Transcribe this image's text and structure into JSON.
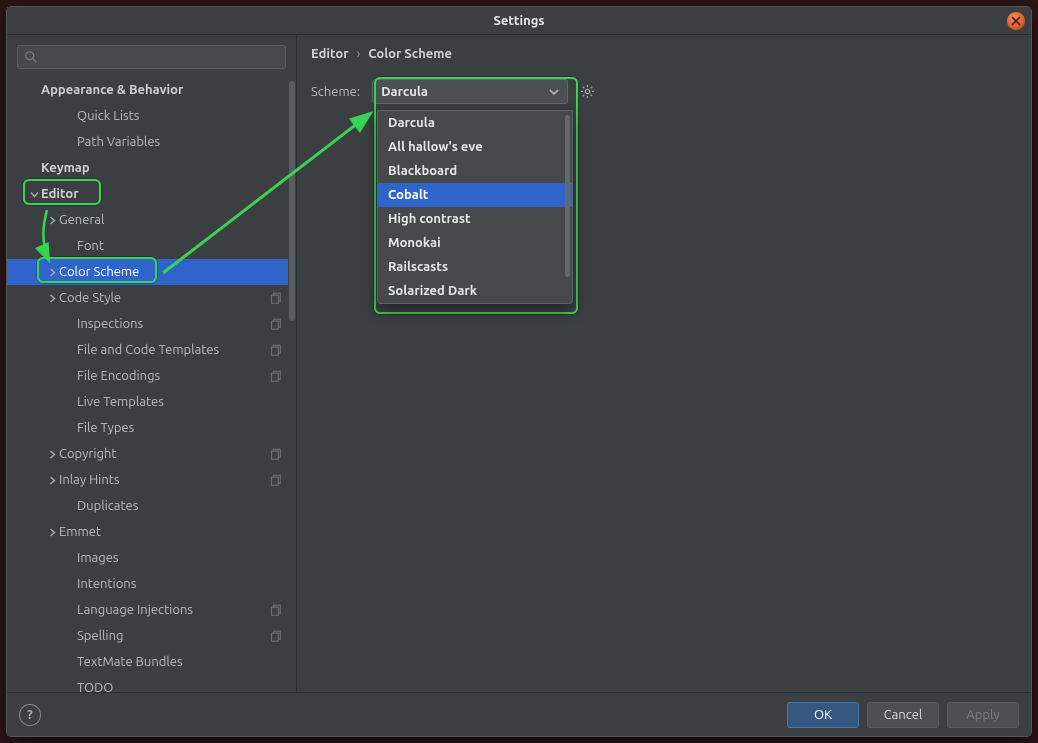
{
  "window": {
    "title": "Settings"
  },
  "breadcrumb": {
    "parent": "Editor",
    "current": "Color Scheme"
  },
  "scheme": {
    "label": "Scheme:",
    "selected": "Darcula",
    "options": [
      "Darcula",
      "All hallow's eve",
      "Blackboard",
      "Cobalt",
      "High contrast",
      "Monokai",
      "Railscasts",
      "Solarized Dark"
    ],
    "highlighted": "Cobalt"
  },
  "sidebar": {
    "search_placeholder": "",
    "items": [
      {
        "label": "Appearance & Behavior",
        "bold": true,
        "indent": 0
      },
      {
        "label": "Quick Lists",
        "indent": 2
      },
      {
        "label": "Path Variables",
        "indent": 2
      },
      {
        "label": "Keymap",
        "bold": true,
        "indent": 0
      },
      {
        "label": "Editor",
        "bold": true,
        "indent": 0,
        "arrow": "down",
        "hl": true
      },
      {
        "label": "General",
        "indent": 1,
        "arrow": "right"
      },
      {
        "label": "Font",
        "indent": 2
      },
      {
        "label": "Color Scheme",
        "indent": 1,
        "arrow": "right",
        "selected": true,
        "hl": true
      },
      {
        "label": "Code Style",
        "indent": 1,
        "arrow": "right",
        "copy": true
      },
      {
        "label": "Inspections",
        "indent": 2,
        "copy": true
      },
      {
        "label": "File and Code Templates",
        "indent": 2,
        "copy": true
      },
      {
        "label": "File Encodings",
        "indent": 2,
        "copy": true
      },
      {
        "label": "Live Templates",
        "indent": 2
      },
      {
        "label": "File Types",
        "indent": 2
      },
      {
        "label": "Copyright",
        "indent": 1,
        "arrow": "right",
        "copy": true
      },
      {
        "label": "Inlay Hints",
        "indent": 1,
        "arrow": "right",
        "copy": true
      },
      {
        "label": "Duplicates",
        "indent": 2
      },
      {
        "label": "Emmet",
        "indent": 1,
        "arrow": "right"
      },
      {
        "label": "Images",
        "indent": 2
      },
      {
        "label": "Intentions",
        "indent": 2
      },
      {
        "label": "Language Injections",
        "indent": 2,
        "copy": true
      },
      {
        "label": "Spelling",
        "indent": 2,
        "copy": true
      },
      {
        "label": "TextMate Bundles",
        "indent": 2
      },
      {
        "label": "TODO",
        "indent": 2
      }
    ]
  },
  "footer": {
    "help": "?",
    "ok": "OK",
    "cancel": "Cancel",
    "apply": "Apply"
  },
  "colors": {
    "accent": "#2f65ca",
    "highlight": "#39d353"
  }
}
